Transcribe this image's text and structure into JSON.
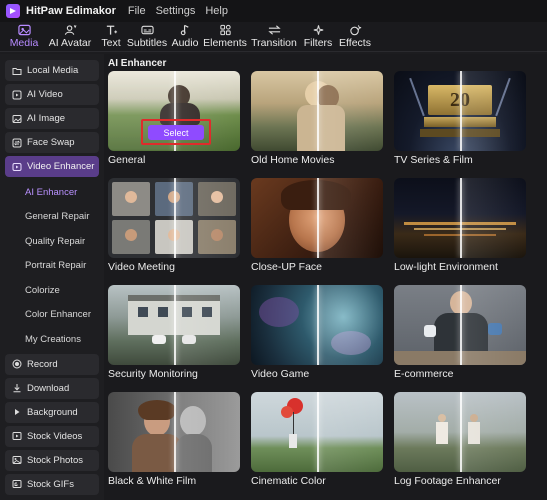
{
  "app": {
    "title": "HitPaw Edimakor",
    "menu": [
      "File",
      "Settings",
      "Help"
    ]
  },
  "toolbar": {
    "items": [
      {
        "label": "Media",
        "icon": "media-icon",
        "active": true
      },
      {
        "label": "AI Avatar",
        "icon": "avatar-icon"
      },
      {
        "label": "Text",
        "icon": "text-icon"
      },
      {
        "label": "Subtitles",
        "icon": "subtitles-icon"
      },
      {
        "label": "Audio",
        "icon": "audio-icon"
      },
      {
        "label": "Elements",
        "icon": "elements-icon"
      },
      {
        "label": "Transition",
        "icon": "transition-icon"
      },
      {
        "label": "Filters",
        "icon": "filters-icon"
      },
      {
        "label": "Effects",
        "icon": "effects-icon"
      }
    ]
  },
  "sidebar": {
    "items": [
      {
        "label": "Local Media",
        "icon": "folder-icon"
      },
      {
        "label": "AI Video",
        "icon": "ai-video-icon"
      },
      {
        "label": "AI Image",
        "icon": "image-icon"
      },
      {
        "label": "Face Swap",
        "icon": "face-swap-icon"
      },
      {
        "label": "Video Enhancer",
        "icon": "video-enhancer-icon",
        "active": true
      }
    ],
    "subitems": [
      {
        "label": "AI Enhancer",
        "active": true
      },
      {
        "label": "General Repair"
      },
      {
        "label": "Quality Repair"
      },
      {
        "label": "Portrait Repair"
      },
      {
        "label": "Colorize"
      },
      {
        "label": "Color Enhancer"
      },
      {
        "label": "My Creations"
      }
    ],
    "lower_items": [
      {
        "label": "Record",
        "icon": "record-icon"
      },
      {
        "label": "Download",
        "icon": "download-icon"
      },
      {
        "label": "Background",
        "icon": "background-icon"
      },
      {
        "label": "Stock Videos",
        "icon": "stock-videos-icon"
      },
      {
        "label": "Stock Photos",
        "icon": "stock-photos-icon"
      },
      {
        "label": "Stock GIFs",
        "icon": "stock-gifs-icon"
      }
    ]
  },
  "main": {
    "section_title": "AI Enhancer",
    "select_label": "Select",
    "cards": [
      {
        "label": "General"
      },
      {
        "label": "Old Home Movies"
      },
      {
        "label": "TV Series & Film"
      },
      {
        "label": "Video Meeting"
      },
      {
        "label": "Close-UP Face"
      },
      {
        "label": "Low-light Environment"
      },
      {
        "label": "Security Monitoring"
      },
      {
        "label": "Video Game"
      },
      {
        "label": "E-commerce"
      },
      {
        "label": "Black & White Film"
      },
      {
        "label": "Cinematic Color"
      },
      {
        "label": "Log Footage Enhancer"
      }
    ]
  },
  "colors": {
    "accent": "#8f4bff",
    "highlight_box": "#e02b2b",
    "sidebar_active": "#5a3d8a"
  }
}
